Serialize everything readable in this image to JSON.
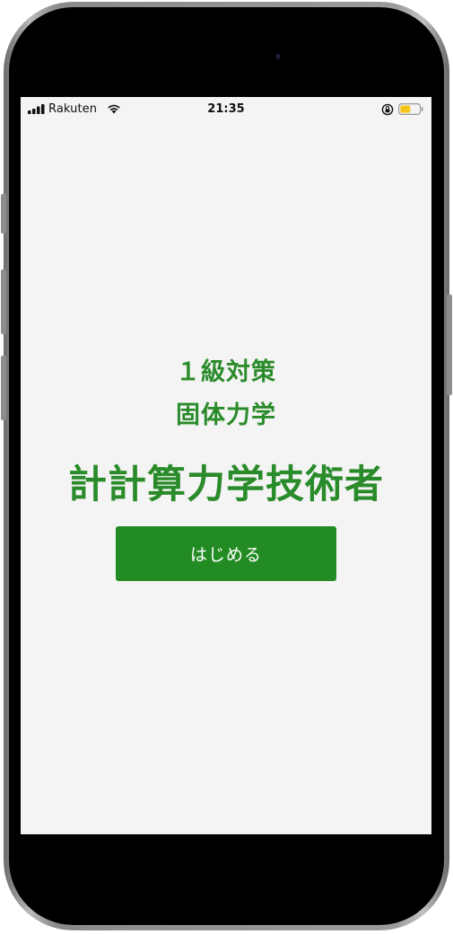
{
  "status_bar": {
    "carrier": "Rakuten",
    "time": "21:35",
    "icons": [
      "signal-icon",
      "wifi-icon",
      "rotation-lock-icon",
      "battery-icon"
    ],
    "battery_color": "#f5c518"
  },
  "main": {
    "subtitle_line1": "１級対策",
    "subtitle_line2": "固体力学",
    "title": "計計算力学技術者",
    "start_button_label": "はじめる"
  },
  "colors": {
    "accent_green": "#238b23",
    "text_green": "#2a8b2a",
    "screen_background": "#f4f4f4"
  }
}
